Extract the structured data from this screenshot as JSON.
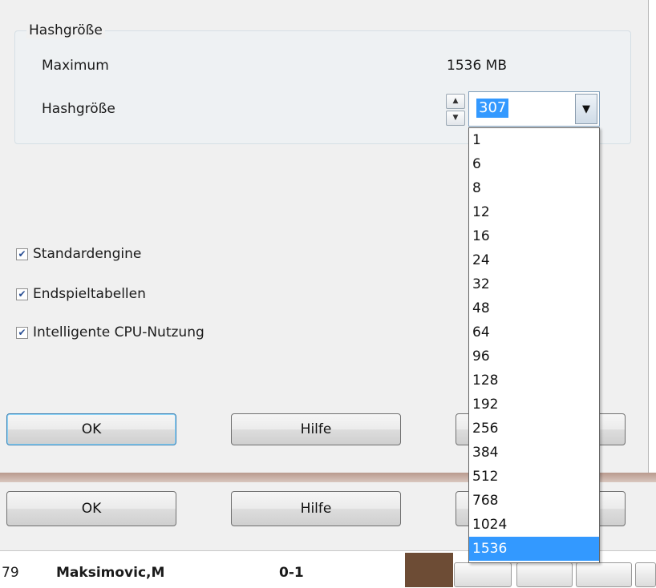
{
  "dialog": {
    "group_title": "Hashgröße",
    "maximum_label": "Maximum",
    "maximum_value": "1536 MB",
    "hash_label": "Hashgröße",
    "hash_value": "307",
    "checkboxes": [
      {
        "label": "Standardengine",
        "checked": true
      },
      {
        "label": "Endspieltabellen",
        "checked": true
      },
      {
        "label": "Intelligente CPU-Nutzung",
        "checked": true
      }
    ],
    "buttons": {
      "ok": "OK",
      "help": "Hilfe"
    }
  },
  "dropdown": {
    "options": [
      "1",
      "6",
      "8",
      "12",
      "16",
      "24",
      "32",
      "48",
      "64",
      "96",
      "128",
      "192",
      "256",
      "384",
      "512",
      "768",
      "1024",
      "1536"
    ],
    "selected": "1536"
  },
  "background_window": {
    "buttons": {
      "ok": "OK",
      "help": "Hilfe"
    },
    "row": {
      "number": "79",
      "player": "Maksimovic,M",
      "result": "0-1"
    }
  },
  "colors": {
    "highlight": "#3399ff",
    "default_button_border": "#3c7fb1"
  }
}
